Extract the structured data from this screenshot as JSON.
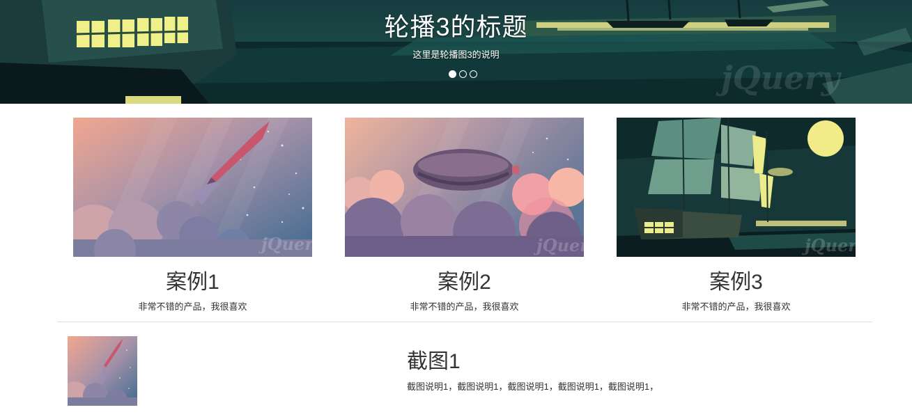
{
  "carousel": {
    "title": "轮播3的标题",
    "description": "这里是轮播图3的说明",
    "slide_count": 3,
    "active_index": 0
  },
  "cases": [
    {
      "title": "案例1",
      "description": "非常不错的产品，我很喜欢",
      "image": "rocket-launch-illustration"
    },
    {
      "title": "案例2",
      "description": "非常不错的产品，我很喜欢",
      "image": "airship-in-clouds-illustration"
    },
    {
      "title": "案例3",
      "description": "非常不错的产品，我很喜欢",
      "image": "sailing-ship-at-night-illustration"
    }
  ],
  "screenshot": {
    "title": "截图1",
    "description": "截图说明1，截图说明1，截图说明1，截图说明1，截图说明1，",
    "image": "rocket-launch-illustration"
  },
  "colors": {
    "text": "#333333",
    "divider": "#dddddd",
    "banner_bg": "#0b2127"
  }
}
